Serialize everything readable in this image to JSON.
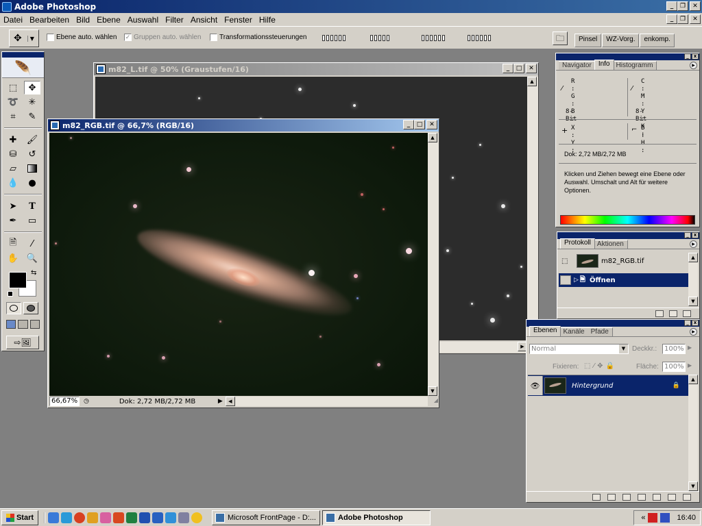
{
  "app": {
    "title": "Adobe Photoshop",
    "menu": [
      "Datei",
      "Bearbeiten",
      "Bild",
      "Ebene",
      "Auswahl",
      "Filter",
      "Ansicht",
      "Fenster",
      "Hilfe"
    ]
  },
  "options_bar": {
    "auto_layer": "Ebene auto. wählen",
    "auto_group": "Gruppen auto. wählen",
    "transform": "Transformationssteuerungen",
    "palette_well": [
      "Pinsel",
      "WZ-Vorg.",
      "enkomp."
    ]
  },
  "windows": {
    "gray": {
      "title": "m82_L.tif @ 50% (Graustufen/16)"
    },
    "rgb": {
      "title": "m82_RGB.tif @ 66,7% (RGB/16)",
      "zoom": "66,67%",
      "doc_size": "Dok: 2,72 MB/2,72 MB"
    }
  },
  "info_palette": {
    "tabs": [
      "Navigator",
      "Info",
      "Histogramm"
    ],
    "active_tab": "Info",
    "rgb_labels": [
      "R :",
      "G :",
      "B :"
    ],
    "cmyk_labels": [
      "C :",
      "M :",
      "Y :",
      "K :"
    ],
    "bit_left": "8-Bit",
    "bit_right": "8-Bit",
    "xy_labels": [
      "X :",
      "Y :"
    ],
    "bh_labels": [
      "B :",
      "H :"
    ],
    "doc_size": "Dok: 2,72 MB/2,72 MB",
    "hint": "Klicken und Ziehen bewegt eine Ebene oder Auswahl. Umschalt und Alt für weitere Optionen."
  },
  "history_palette": {
    "tabs": [
      "Protokoll",
      "Aktionen"
    ],
    "active_tab": "Protokoll",
    "snapshot": "m82_RGB.tif",
    "step": "Öffnen"
  },
  "layers_palette": {
    "tabs": [
      "Ebenen",
      "Kanäle",
      "Pfade"
    ],
    "active_tab": "Ebenen",
    "blend_mode": "Normal",
    "opacity_label": "Deckkr.:",
    "opacity": "100%",
    "lock_label": "Fixieren:",
    "fill_label": "Fläche:",
    "fill": "100%",
    "layer_name": "Hintergrund"
  },
  "taskbar": {
    "start": "Start",
    "tasks": [
      "Microsoft FrontPage - D:...",
      "Adobe Photoshop"
    ],
    "active_task": "Adobe Photoshop",
    "clock": "16:40",
    "tray_arrow": "«"
  },
  "colors": {
    "title_active": "#0a246a",
    "face": "#d4d0c8",
    "desktop": "#808080",
    "foreground_color": "#000000",
    "background_color": "#ffffff"
  }
}
